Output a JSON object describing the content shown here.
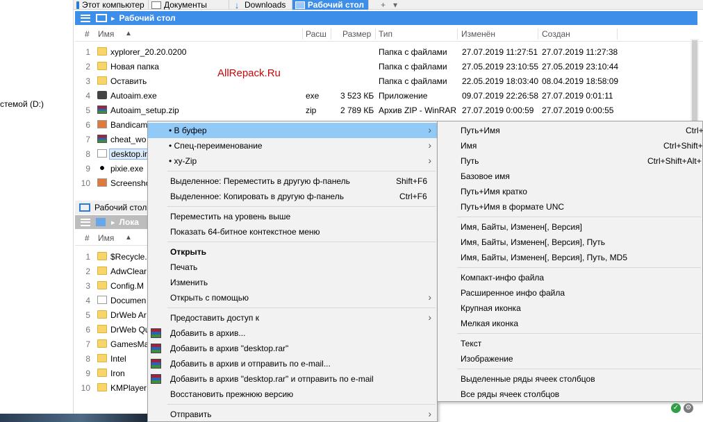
{
  "tabs": [
    {
      "label": "Этот компьютер",
      "icon": "computer-icon"
    },
    {
      "label": "Документы",
      "icon": "document-icon"
    },
    {
      "label": "Downloads",
      "icon": "download-icon"
    },
    {
      "label": "Рабочий стол",
      "icon": "desktop-icon",
      "active": true
    }
  ],
  "tab_add": "+",
  "tab_menu": "▾",
  "left_drive": "стемой (D:)",
  "pane1": {
    "path": "Рабочий стол",
    "columns": {
      "num": "#",
      "name": "Имя",
      "ext": "Расш",
      "size": "Размер",
      "type": "Тип",
      "modified": "Изменён",
      "created": "Создан"
    },
    "rows": [
      {
        "num": "1",
        "name": "xyplorer_20.20.0200",
        "ext": "",
        "size": "",
        "type": "Папка с файлами",
        "modified": "27.07.2019 11:27:51",
        "created": "27.07.2019 11:27:38",
        "icon": "folder"
      },
      {
        "num": "2",
        "name": "Новая папка",
        "ext": "",
        "size": "",
        "type": "Папка с файлами",
        "modified": "27.05.2019 23:10:55",
        "created": "27.05.2019 23:10:44",
        "icon": "folder"
      },
      {
        "num": "3",
        "name": "Оставить",
        "ext": "",
        "size": "",
        "type": "Папка с файлами",
        "modified": "22.05.2019 18:03:40",
        "created": "08.04.2019 18:58:09",
        "icon": "folder"
      },
      {
        "num": "4",
        "name": "Autoaim.exe",
        "ext": "exe",
        "size": "3 523 КБ",
        "type": "Приложение",
        "modified": "09.07.2019 22:26:58",
        "created": "27.07.2019 0:01:11",
        "icon": "exe"
      },
      {
        "num": "5",
        "name": "Autoaim_setup.zip",
        "ext": "zip",
        "size": "2 789 КБ",
        "type": "Архив ZIP - WinRAR",
        "modified": "27.07.2019 0:00:59",
        "created": "27.07.2019 0:00:55",
        "icon": "rar"
      },
      {
        "num": "6",
        "name": "Bandicam",
        "icon": "img"
      },
      {
        "num": "7",
        "name": "cheat_wo",
        "icon": "rar"
      },
      {
        "num": "8",
        "name": "desktop.in",
        "icon": "txt",
        "selected": true
      },
      {
        "num": "9",
        "name": "pixie.exe",
        "icon": "pix"
      },
      {
        "num": "10",
        "name": "Screensho",
        "icon": "img"
      }
    ]
  },
  "pane2": {
    "title": "Рабочий стол",
    "path": "Лока",
    "columns": {
      "num": "#",
      "name": "Имя"
    },
    "rows": [
      {
        "num": "1",
        "name": "$Recycle.",
        "icon": "folder"
      },
      {
        "num": "2",
        "name": "AdwClear",
        "icon": "folder"
      },
      {
        "num": "3",
        "name": "Config.M",
        "icon": "folder"
      },
      {
        "num": "4",
        "name": "Documen",
        "icon": "folder"
      },
      {
        "num": "5",
        "name": "DrWeb Ar",
        "icon": "folder"
      },
      {
        "num": "6",
        "name": "DrWeb Qu",
        "icon": "folder"
      },
      {
        "num": "7",
        "name": "GamesMa",
        "icon": "folder"
      },
      {
        "num": "8",
        "name": "Intel",
        "icon": "folder"
      },
      {
        "num": "9",
        "name": "Iron",
        "icon": "folder"
      },
      {
        "num": "10",
        "name": "KMPlayer",
        "icon": "folder"
      }
    ]
  },
  "watermark": "AllRepack.Ru",
  "context_menu": [
    {
      "label": "• В буфер",
      "submenu": true,
      "highlight": true
    },
    {
      "label": "• Спец-переименование",
      "submenu": true
    },
    {
      "label": "• xy-Zip",
      "submenu": true
    },
    {
      "sep": true
    },
    {
      "label": "Выделенное:  Переместить в другую ф-панель",
      "shortcut": "Shift+F6"
    },
    {
      "label": "Выделенное:  Копировать в другую ф-панель",
      "shortcut": "Ctrl+F6"
    },
    {
      "sep": true
    },
    {
      "label": "Переместить на уровень выше"
    },
    {
      "label": "Показать 64-битное контекстное меню"
    },
    {
      "sep": true
    },
    {
      "label": "Открыть",
      "bold": true
    },
    {
      "label": "Печать"
    },
    {
      "label": "Изменить"
    },
    {
      "label": "Открыть с помощью",
      "submenu": true
    },
    {
      "sep": true
    },
    {
      "label": "Предоставить доступ к",
      "submenu": true
    },
    {
      "label": "Добавить в архив...",
      "winrar": true
    },
    {
      "label": "Добавить в архив \"desktop.rar\"",
      "winrar": true
    },
    {
      "label": "Добавить в архив и отправить по e-mail...",
      "winrar": true
    },
    {
      "label": "Добавить в архив \"desktop.rar\" и отправить по e-mail",
      "winrar": true
    },
    {
      "label": "Восстановить прежнюю версию"
    },
    {
      "sep": true
    },
    {
      "label": "Отправить",
      "submenu": true
    }
  ],
  "submenu": [
    {
      "label": "Путь+Имя",
      "shortcut": "Ctrl+"
    },
    {
      "label": "Имя",
      "shortcut": "Ctrl+Shift+"
    },
    {
      "label": "Путь",
      "shortcut": "Ctrl+Shift+Alt+"
    },
    {
      "label": "Базовое имя"
    },
    {
      "label": "Путь+Имя кратко"
    },
    {
      "label": "Путь+Имя в формате UNC"
    },
    {
      "sep": true
    },
    {
      "label": "Имя, Байты, Изменен[, Версия]"
    },
    {
      "label": "Имя, Байты, Изменен[, Версия], Путь"
    },
    {
      "label": "Имя, Байты, Изменен[, Версия], Путь, MD5"
    },
    {
      "sep": true
    },
    {
      "label": "Компакт-инфо файла"
    },
    {
      "label": "Расширенное инфо файла"
    },
    {
      "label": "Крупная иконка"
    },
    {
      "label": "Мелкая иконка"
    },
    {
      "sep": true
    },
    {
      "label": "Текст"
    },
    {
      "label": "Изображение"
    },
    {
      "sep": true
    },
    {
      "label": "Выделенные ряды ячеек столбцов"
    },
    {
      "label": "Все ряды ячеек столбцов"
    }
  ],
  "colors": {
    "accent": "#3c8ee8",
    "menu_highlight": "#91c9f7",
    "watermark": "#c6070d"
  }
}
